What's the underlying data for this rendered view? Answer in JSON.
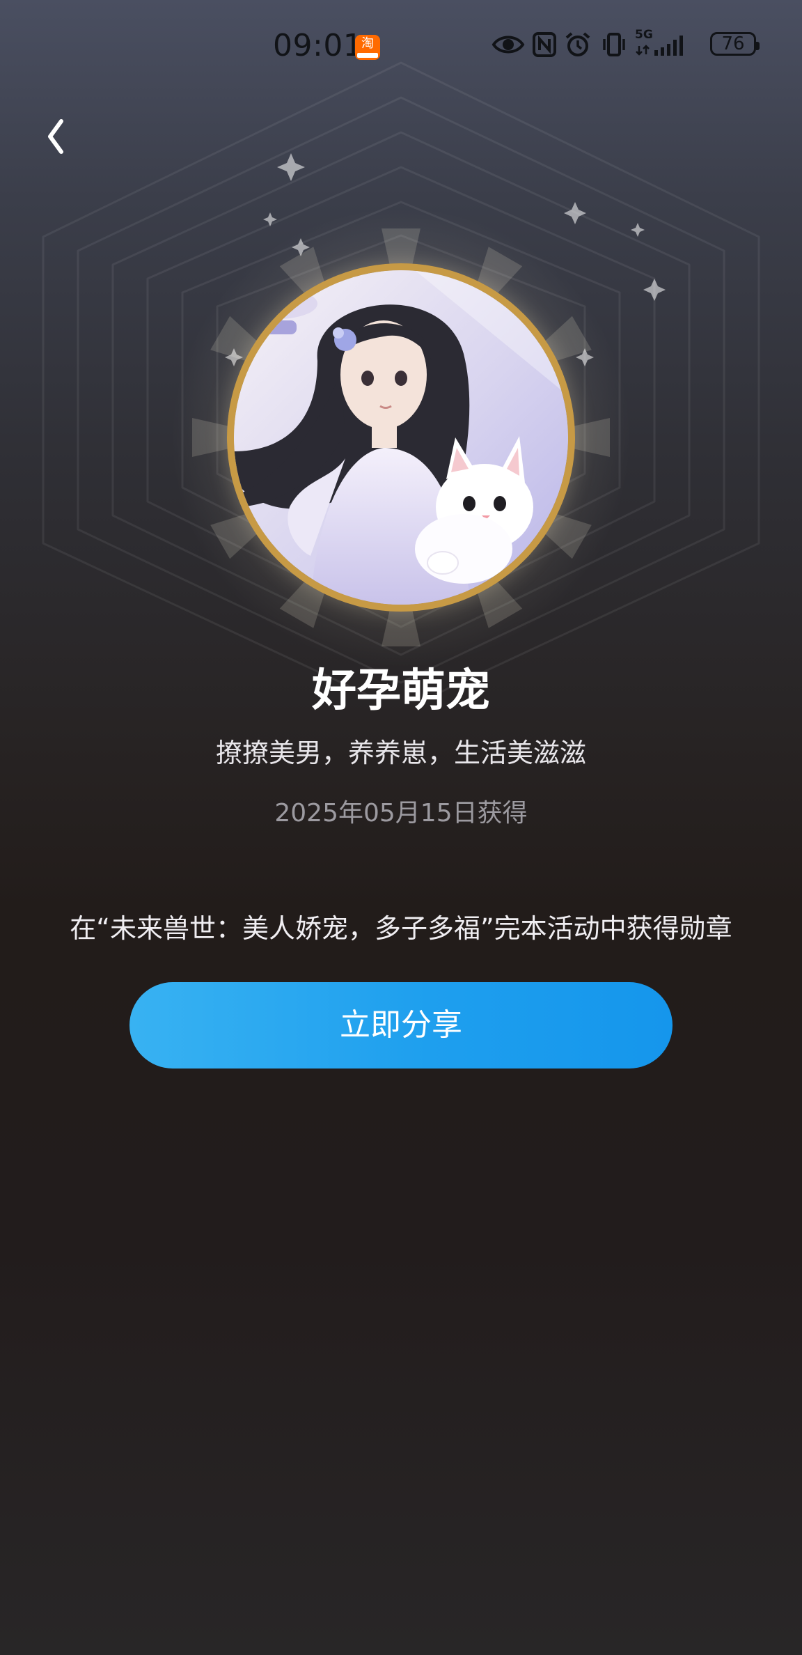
{
  "status_bar": {
    "time": "09:01",
    "notification_app_icon": "taobao-app-icon",
    "notification_app_glyph": "淘",
    "network": "5G",
    "battery": "76"
  },
  "nav": {
    "back_icon": "chevron-left-icon"
  },
  "medal": {
    "title": "好孕萌宠",
    "subtitle": "撩撩美男，养养崽，生活美滋滋",
    "date": "2025年05月15日获得",
    "description": "在“未来兽世：美人娇宠，多子多福”完本活动中获得勋章",
    "image": "medal-illustration-girl-with-white-cat"
  },
  "actions": {
    "share_label": "立即分享"
  },
  "colors": {
    "share_button_start": "#38b2f2",
    "share_button_end": "#1596ec",
    "medal_ring": "#c79a45",
    "taobao_orange": "#ff6a00"
  }
}
